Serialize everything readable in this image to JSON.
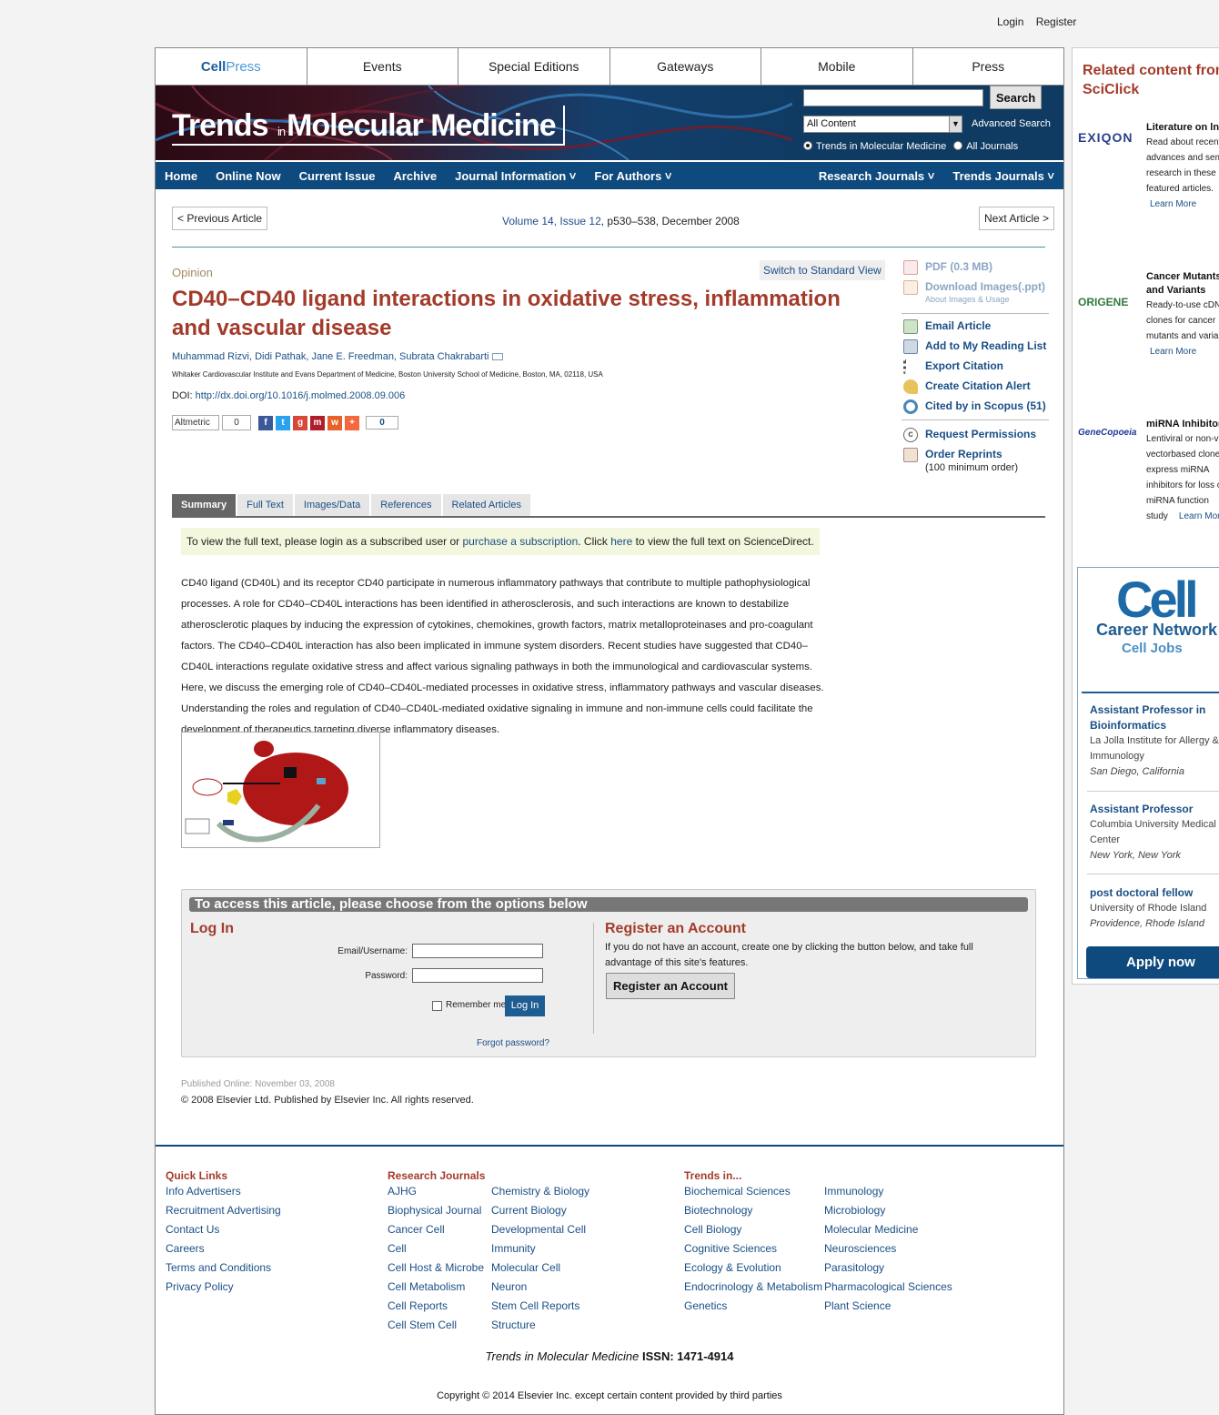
{
  "top": {
    "login": "Login",
    "register": "Register"
  },
  "cellpress_nav": {
    "logo_cell": "Cell",
    "logo_press": "Press",
    "items": [
      "Events",
      "Special Editions",
      "Gateways",
      "Mobile",
      "Press"
    ]
  },
  "banner": {
    "title_trends": "Trends",
    "title_in": "in",
    "title_rest": "Molecular Medicine",
    "search_button": "Search",
    "search_value": "",
    "select_value": "All Content",
    "advanced_search": "Advanced Search",
    "radio_journal": "Trends in Molecular Medicine",
    "radio_all": "All Journals"
  },
  "main_nav": {
    "items": [
      "Home",
      "Online Now",
      "Current Issue",
      "Archive",
      "Journal Information ˅",
      "For Authors ˅"
    ],
    "right": [
      "Research Journals ˅",
      "Trends Journals ˅"
    ]
  },
  "article_nav": {
    "prev": "< Previous Article",
    "next": "Next Article >",
    "volume": "Volume 14, Issue 12",
    "pages": ", p530–538, December 2008"
  },
  "article": {
    "type": "Opinion",
    "switch_view": "Switch to Standard View",
    "title": "CD40–CD40 ligand interactions in oxidative stress, inflammation and vascular disease",
    "authors": "Muhammad Rizvi, Didi Pathak, Jane E. Freedman, Subrata Chakrabarti",
    "affiliation": "Whitaker Cardiovascular Institute and Evans Department of Medicine, Boston University School of Medicine, Boston, MA, 02118, USA",
    "doi_label": "DOI: ",
    "doi": "http://dx.doi.org/10.1016/j.molmed.2008.09.006",
    "altmetric": "Altmetric",
    "altmetric_count": "0",
    "share_count": "0"
  },
  "tools": {
    "pdf": "PDF (0.3 MB)",
    "download_images": "Download Images(.ppt)",
    "about_images": "About Images & Usage",
    "email": "Email Article",
    "reading_list": "Add to My Reading List",
    "export": "Export Citation",
    "alert": "Create Citation Alert",
    "cited": "Cited by in Scopus (51)",
    "permissions": "Request Permissions",
    "reprints": "Order Reprints",
    "reprints_note": "(100 minimum order)"
  },
  "tabs": [
    "Summary",
    "Full Text",
    "Images/Data",
    "References",
    "Related Articles"
  ],
  "notice": {
    "pre": "To view the full text, please login as a subscribed user or ",
    "link1": "purchase a subscription",
    "mid": ". Click ",
    "link2": "here",
    "post": " to view the full text on ScienceDirect."
  },
  "abstract": "CD40 ligand (CD40L) and its receptor CD40 participate in numerous inflammatory pathways that contribute to multiple pathophysiological processes. A role for CD40–CD40L interactions has been identified in atherosclerosis, and such interactions are known to destabilize atherosclerotic plaques by inducing the expression of cytokines, chemokines, growth factors, matrix metalloproteinases and pro-coagulant factors. The CD40–CD40L interaction has also been implicated in immune system disorders. Recent studies have suggested that CD40–CD40L interactions regulate oxidative stress and affect various signaling pathways in both the immunological and cardiovascular systems. Here, we discuss the emerging role of CD40–CD40L-mediated processes in oxidative stress, inflammatory pathways and vascular diseases. Understanding the roles and regulation of CD40–CD40L-mediated oxidative signaling in immune and non-immune cells could facilitate the development of therapeutics targeting diverse inflammatory diseases.",
  "access": {
    "heading": "To access this article, please choose from the options below",
    "login_title": "Log In",
    "email_label": "Email/Username:",
    "password_label": "Password:",
    "remember": "Remember me",
    "login_button": "Log In",
    "forgot": "Forgot password?",
    "register_title": "Register an Account",
    "register_text": "If you do not have an account, create one by clicking the button below, and take full advantage of this site's features.",
    "register_button": "Register an Account"
  },
  "published": "Published Online: November 03, 2008",
  "copyright_article": "© 2008 Elsevier Ltd. Published by Elsevier Inc. All rights reserved.",
  "footer": {
    "quick_links_title": "Quick Links",
    "quick_links": [
      "Info Advertisers",
      "Recruitment Advertising",
      "Contact Us",
      "Careers",
      "Terms and Conditions",
      "Privacy Policy"
    ],
    "research_title": "Research Journals",
    "research_col1": [
      "AJHG",
      "Biophysical Journal",
      "Cancer Cell",
      "Cell",
      "Cell Host & Microbe",
      "Cell Metabolism",
      "Cell Reports",
      "Cell Stem Cell"
    ],
    "research_col2": [
      "Chemistry & Biology",
      "Current Biology",
      "Developmental Cell",
      "Immunity",
      "Molecular Cell",
      "Neuron",
      "Stem Cell Reports",
      "Structure"
    ],
    "trends_title": "Trends in...",
    "trends_col1": [
      "Biochemical Sciences",
      "Biotechnology",
      "Cell Biology",
      "Cognitive Sciences",
      "Ecology & Evolution",
      "Endocrinology & Metabolism",
      "Genetics"
    ],
    "trends_col2": [
      "Immunology",
      "Microbiology",
      "Molecular Medicine",
      "Neurosciences",
      "Parasitology",
      "Pharmacological Sciences",
      "Plant Science"
    ],
    "issn_journal": "Trends in Molecular Medicine",
    "issn": " ISSN: 1471-4914",
    "copyright": "Copyright © 2014 Elsevier Inc. except certain content provided by third parties"
  },
  "sidebar": {
    "heading": "Related content from SciClick",
    "ads": [
      {
        "logo": "EXIQON",
        "title": "Literature on lncRNA inhibitors",
        "lines": [
          "Read about recent",
          "advances and semi",
          "research in these",
          "featured articles."
        ],
        "link": "Learn More"
      },
      {
        "logo": "ORIGENE",
        "title": "Cancer Mutants and Variants",
        "lines": [
          "Ready-to-use cDNA",
          "clones for cancer",
          "mutants and variants"
        ],
        "link": "Learn More"
      },
      {
        "logo": "GeneCopoeia",
        "title": "miRNA Inhibitors",
        "lines": [
          "Lentiviral or non-viral",
          "vectorbased clones",
          "express miRNA",
          "inhibitors for loss of",
          "miRNA function"
        ],
        "last": "study",
        "link": "Learn More"
      }
    ],
    "career": {
      "logo": "Cell",
      "network": "Career Network",
      "jobs": "Cell Jobs",
      "listings": [
        {
          "title": "Assistant Professor in Bioinformatics",
          "org": "La Jolla Institute for Allergy & Immunology",
          "loc": "San Diego, California"
        },
        {
          "title": "Assistant Professor",
          "org": "Columbia University Medical Center",
          "loc": "New York, New York"
        },
        {
          "title": "post doctoral fellow",
          "org": "University of Rhode Island",
          "loc": "Providence, Rhode Island"
        }
      ],
      "apply": "Apply now"
    }
  },
  "colors": {
    "brand_blue": "#0e4a7d",
    "accent_red": "#a33b2b",
    "link": "#1a4f86"
  }
}
